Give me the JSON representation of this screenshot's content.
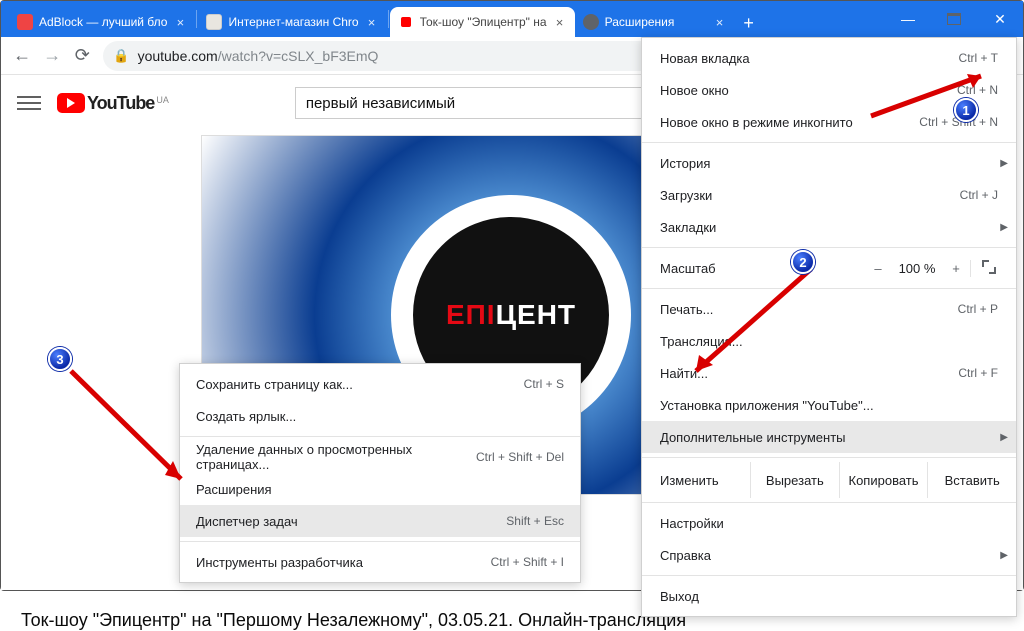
{
  "tabs": [
    {
      "title": "AdBlock — лучший бло"
    },
    {
      "title": "Интернет-магазин Chro"
    },
    {
      "title": "Ток-шоу \"Эпицентр\" на"
    },
    {
      "title": "Расширения"
    }
  ],
  "window_controls": {
    "min": "—",
    "max": "▢",
    "close": "✕"
  },
  "omnibox": {
    "scheme_host": "youtube.com",
    "path": "/watch?v=cSLX_bF3EmQ"
  },
  "youtube": {
    "brand": "YouTube",
    "region": "UA",
    "search_value": "первый независимый",
    "thumb_text_a": "ЕПІ",
    "thumb_text_b": "ЦЕНТ"
  },
  "page_title": "Ток-шоу \"Эпицентр\" на \"Першому Незалежному\", 03.05.21. Онлайн-трансляция",
  "chrome_menu": {
    "new_tab": "Новая вкладка",
    "new_tab_sc": "Ctrl + T",
    "new_window": "Новое окно",
    "new_window_sc": "Ctrl + N",
    "incognito": "Новое окно в режиме инкогнито",
    "incognito_sc": "Ctrl + Shift + N",
    "history": "История",
    "downloads": "Загрузки",
    "downloads_sc": "Ctrl + J",
    "bookmarks": "Закладки",
    "zoom": "Масштаб",
    "zoom_val": "100 %",
    "zoom_minus": "–",
    "zoom_plus": "+",
    "print": "Печать...",
    "print_sc": "Ctrl + P",
    "cast": "Трансляция...",
    "find": "Найти...",
    "find_sc": "Ctrl + F",
    "install": "Установка приложения \"YouTube\"...",
    "more_tools": "Дополнительные инструменты",
    "edit": "Изменить",
    "cut": "Вырезать",
    "copy": "Копировать",
    "paste": "Вставить",
    "settings": "Настройки",
    "help": "Справка",
    "exit": "Выход"
  },
  "submenu": {
    "save_as": "Сохранить страницу как...",
    "save_as_sc": "Ctrl + S",
    "shortcut": "Создать ярлык...",
    "clear": "Удаление данных о просмотренных страницах...",
    "clear_sc": "Ctrl + Shift + Del",
    "extensions": "Расширения",
    "task_mgr": "Диспетчер задач",
    "task_mgr_sc": "Shift + Esc",
    "devtools": "Инструменты разработчика",
    "devtools_sc": "Ctrl + Shift + I"
  },
  "badges": {
    "b1": "1",
    "b2": "2",
    "b3": "3"
  }
}
